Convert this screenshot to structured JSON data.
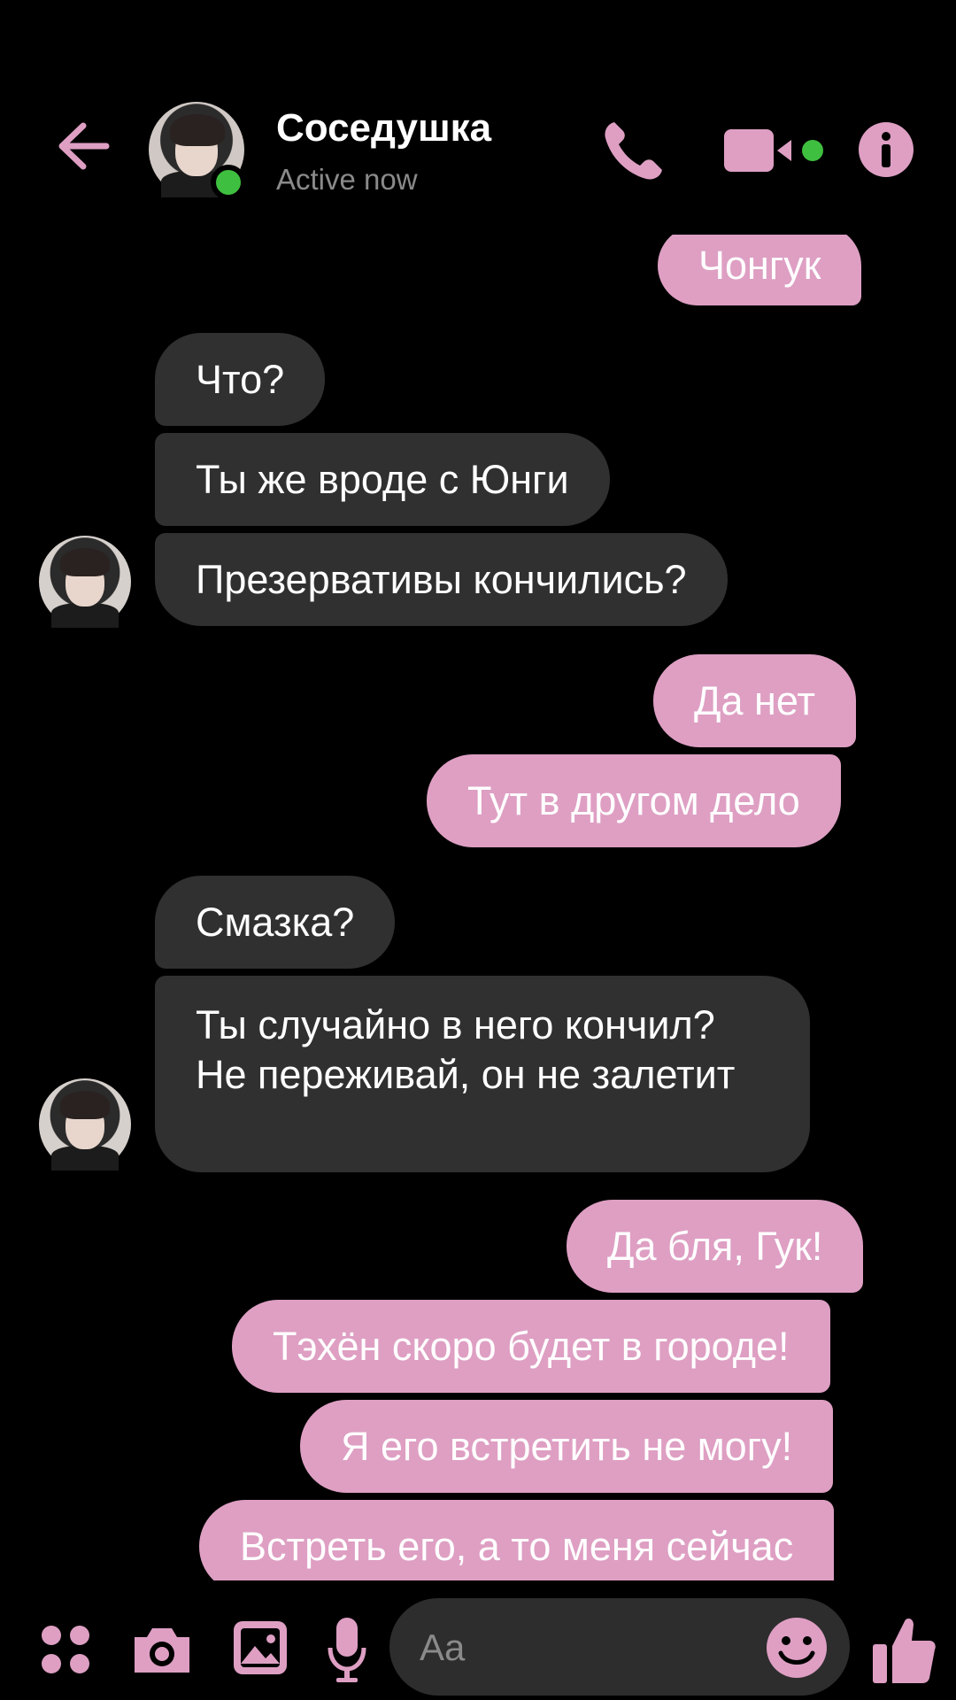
{
  "header": {
    "contact_name": "Соседушка",
    "status": "Active now",
    "icons": {
      "back": "arrow-left-icon",
      "call": "phone-icon",
      "video": "video-camera-icon",
      "info": "info-icon"
    }
  },
  "messages": [
    {
      "direction": "outgoing",
      "text": "Чонгук"
    },
    {
      "direction": "incoming",
      "text": "Что?"
    },
    {
      "direction": "incoming",
      "text": "Ты же вроде с Юнги"
    },
    {
      "direction": "incoming",
      "text": "Презервативы кончились?"
    },
    {
      "direction": "outgoing",
      "text": "Да нет"
    },
    {
      "direction": "outgoing",
      "text": "Тут в другом дело"
    },
    {
      "direction": "incoming",
      "text": "Смазка?"
    },
    {
      "direction": "incoming",
      "text": "Ты случайно в него кончил? Не переживай, он не залетит"
    },
    {
      "direction": "outgoing",
      "text": "Да бля, Гук!"
    },
    {
      "direction": "outgoing",
      "text": "Тэхён скоро будет в городе!"
    },
    {
      "direction": "outgoing",
      "text": "Я его встретить не могу!"
    },
    {
      "direction": "outgoing",
      "text": "Встреть его, а то меня сейчас"
    }
  ],
  "composer": {
    "placeholder": "Aa",
    "icons": [
      "apps-icon",
      "camera-icon",
      "gallery-icon",
      "microphone-icon",
      "emoji-icon",
      "thumbs-up-icon"
    ]
  },
  "colors": {
    "accent": "#de9fc3",
    "incoming_bubble": "#303030",
    "background": "#000000",
    "online": "#3fbf3f"
  }
}
